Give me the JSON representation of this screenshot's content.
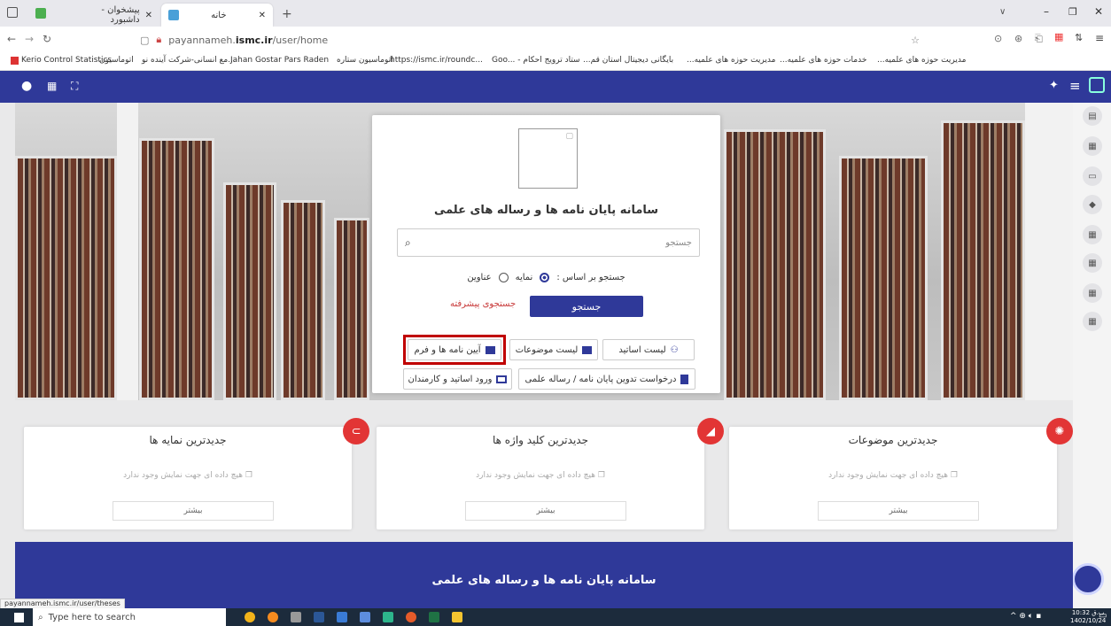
{
  "browser": {
    "tabs": [
      {
        "label": "پیشخوان - داشبورد"
      },
      {
        "label": "خانه"
      }
    ],
    "url_prefix": "payannameh.",
    "url_domain": "ismc.ir",
    "url_path": "/user/home",
    "bookmarks": [
      "Kerio Control Statistics",
      "اتوماسیون",
      "مع انسانی-شرکت آینده نو...",
      "Jahan Gostar Pars Raden",
      "اتوماسیون ستاره",
      "https://ismc.ir/roundc...",
      "Goo... - ستاد ترویج احکام",
      "...بایگانی دیجیتال استان قم",
      "...مدیریت حوزه های علمیه",
      "...خدمات حوزه های علمیه",
      "...مدیریت حوزه های علمیه"
    ],
    "status_url": "payannameh.ismc.ir/user/theses"
  },
  "search_card": {
    "title": "سامانه پایان نامه ها و رساله های علمی",
    "search_placeholder": "جستجو",
    "search_by_label": "جستجو بر اساس :",
    "option_index": "نمایه",
    "option_titles": "عناوین",
    "search_button": "جستجو",
    "advanced_link": "جستجوی پیشرفته",
    "btn_teachers": "لیست اساتید",
    "btn_topics": "لیست موضوعات",
    "btn_regulations": "آیین نامه ها و فرم",
    "btn_request": "درخواست تدوین پایان نامه / رساله علمی",
    "btn_login": "ورود اساتید و کارمندان"
  },
  "cards": [
    {
      "title": "جدیدترین موضوعات",
      "empty": "هیچ داده ای جهت نمایش وجود ندارد",
      "more": "بیشتر"
    },
    {
      "title": "جدیدترین کلید واژه ها",
      "empty": "هیچ داده ای جهت نمایش وجود ندارد",
      "more": "بیشتر"
    },
    {
      "title": "جدیدترین نمایه ها",
      "empty": "هیچ داده ای جهت نمایش وجود ندارد",
      "more": "بیشتر"
    }
  ],
  "footer": {
    "title": "سامانه پایان نامه ها و رساله های علمی"
  },
  "taskbar": {
    "search": "Type here to search",
    "time": "10:32 ب.ق",
    "date": "1402/10/24"
  },
  "colors": {
    "primary": "#2f3999",
    "accent": "#e23535",
    "highlight": "#c00000"
  }
}
